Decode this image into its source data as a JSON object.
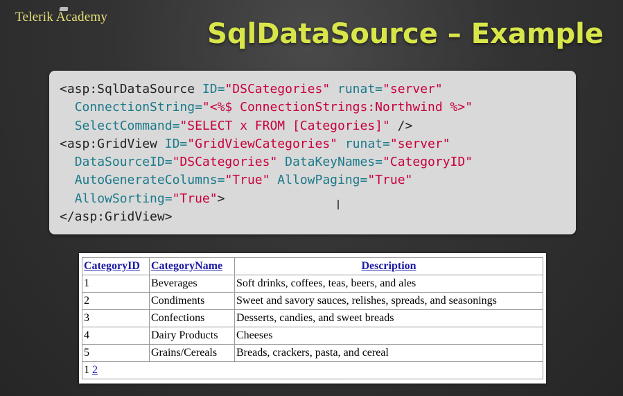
{
  "brand": {
    "logo_text": "Telerik Academy"
  },
  "slide": {
    "title": "SqlDataSource – Example"
  },
  "code": {
    "l1": {
      "tag": "<asp:SqlDataSource",
      "a1": " ID=",
      "v1": "\"DSCategories\"",
      "a2": " runat=",
      "v2": "\"server\""
    },
    "l2": {
      "indent": "  ",
      "a1": "ConnectionString=",
      "v1": "\"<%$ ConnectionStrings:Northwind %>\""
    },
    "l3": {
      "indent": "  ",
      "a1": "SelectCommand=",
      "v1": "\"SELECT x FROM [Categories]\"",
      "end": " />"
    },
    "l4": {
      "tag": "<asp:GridView",
      "a1": " ID=",
      "v1": "\"GridViewCategories\"",
      "a2": " runat=",
      "v2": "\"server\""
    },
    "l5": {
      "indent": "  ",
      "a1": "DataSourceID=",
      "v1": "\"DSCategories\"",
      "a2": " DataKeyNames=",
      "v2": "\"CategoryID\""
    },
    "l6": {
      "indent": "  ",
      "a1": "AutoGenerateColumns=",
      "v1": "\"True\"",
      "a2": " AllowPaging=",
      "v2": "\"True\""
    },
    "l7": {
      "indent": "  ",
      "a1": "AllowSorting=",
      "v1": "\"True\"",
      "end": ">"
    },
    "l8": {
      "tag": "</asp:GridView>"
    }
  },
  "grid": {
    "headers": [
      "CategoryID",
      "CategoryName",
      "Description"
    ],
    "rows": [
      [
        "1",
        "Beverages",
        "Soft drinks, coffees, teas, beers, and ales"
      ],
      [
        "2",
        "Condiments",
        "Sweet and savory sauces, relishes, spreads, and seasonings"
      ],
      [
        "3",
        "Confections",
        "Desserts, candies, and sweet breads"
      ],
      [
        "4",
        "Dairy Products",
        "Cheeses"
      ],
      [
        "5",
        "Grains/Cereals",
        "Breads, crackers, pasta, and cereal"
      ]
    ],
    "pager": {
      "current": "1",
      "next": "2"
    }
  },
  "colors": {
    "title": "#d8e64a",
    "logo": "#e8e27a",
    "attr": "#1a7a8a",
    "value": "#c8003c",
    "link": "#1a1aa6"
  }
}
